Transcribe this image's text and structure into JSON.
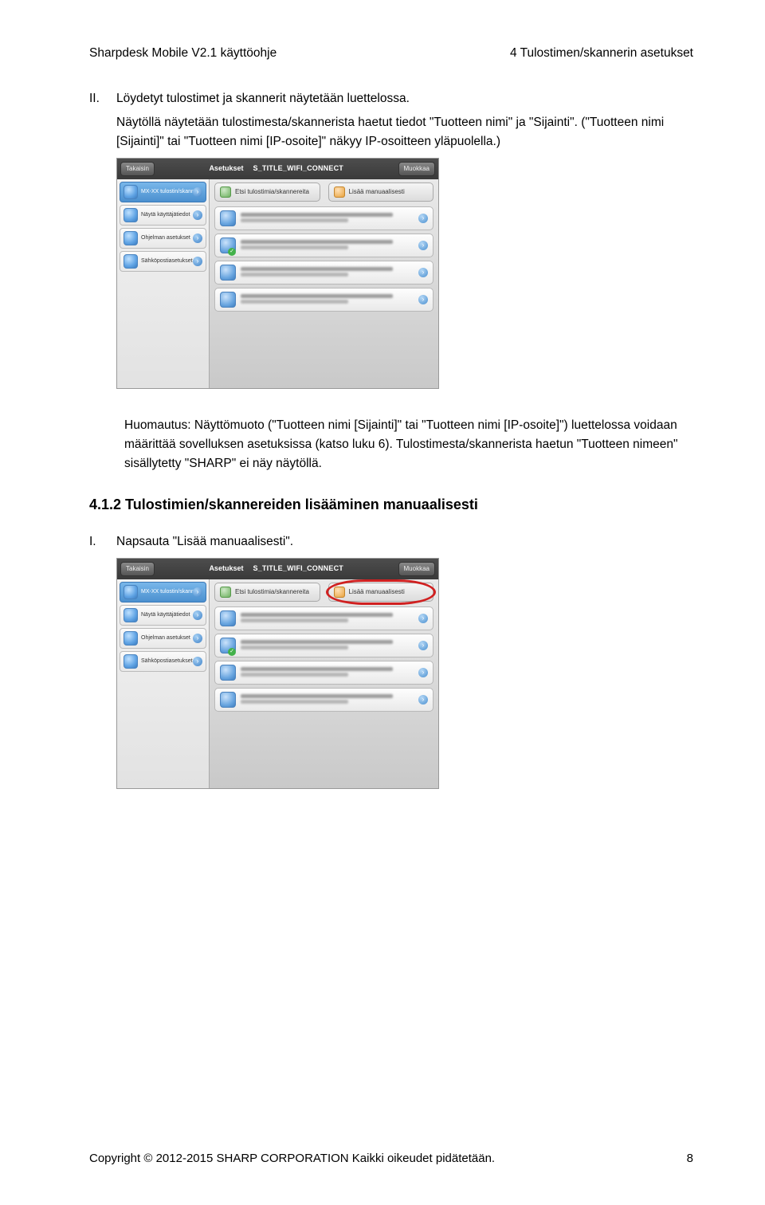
{
  "header": {
    "left": "Sharpdesk Mobile V2.1 käyttöohje",
    "right": "4 Tulostimen/skannerin asetukset"
  },
  "body": {
    "item2_marker": "II.",
    "item2_text": "Löydetyt tulostimet ja skannerit näytetään luettelossa.",
    "item2_para": "Näytöllä näytetään tulostimesta/skannerista haetut tiedot \"Tuotteen nimi\" ja \"Sijainti\". (\"Tuotteen nimi [Sijainti]\" tai \"Tuotteen nimi [IP-osoite]\" näkyy IP-osoitteen yläpuolella.)",
    "note": "Huomautus: Näyttömuoto (\"Tuotteen nimi [Sijainti]\" tai \"Tuotteen nimi [IP-osoite]\") luettelossa voidaan määrittää sovelluksen asetuksissa (katso luku 6). Tulostimesta/skannerista haetun \"Tuotteen nimeen\" sisällytetty \"SHARP\" ei näy näytöllä.",
    "section_heading": "4.1.2   Tulostimien/skannereiden lisääminen manuaalisesti",
    "step1_marker": "I.",
    "step1_text": "Napsauta \"Lisää manuaalisesti\"."
  },
  "screenshot": {
    "back_button": "Takaisin",
    "title": "S_TITLE_WIFI_CONNECT",
    "edit_button": "Muokkaa",
    "sidebar_header": "Asetukset",
    "sidebar_items": [
      "MX-XX tulostin/skanneri",
      "Näytä käyttäjätiedot",
      "Ohjelman asetukset",
      "Sähköpostiasetukset"
    ],
    "btn_search": "Etsi tulostimia/skannereita",
    "btn_manual": "Lisää manuaalisesti"
  },
  "footer": {
    "copyright": "Copyright © 2012-2015 SHARP CORPORATION Kaikki oikeudet pidätetään.",
    "page": "8"
  }
}
